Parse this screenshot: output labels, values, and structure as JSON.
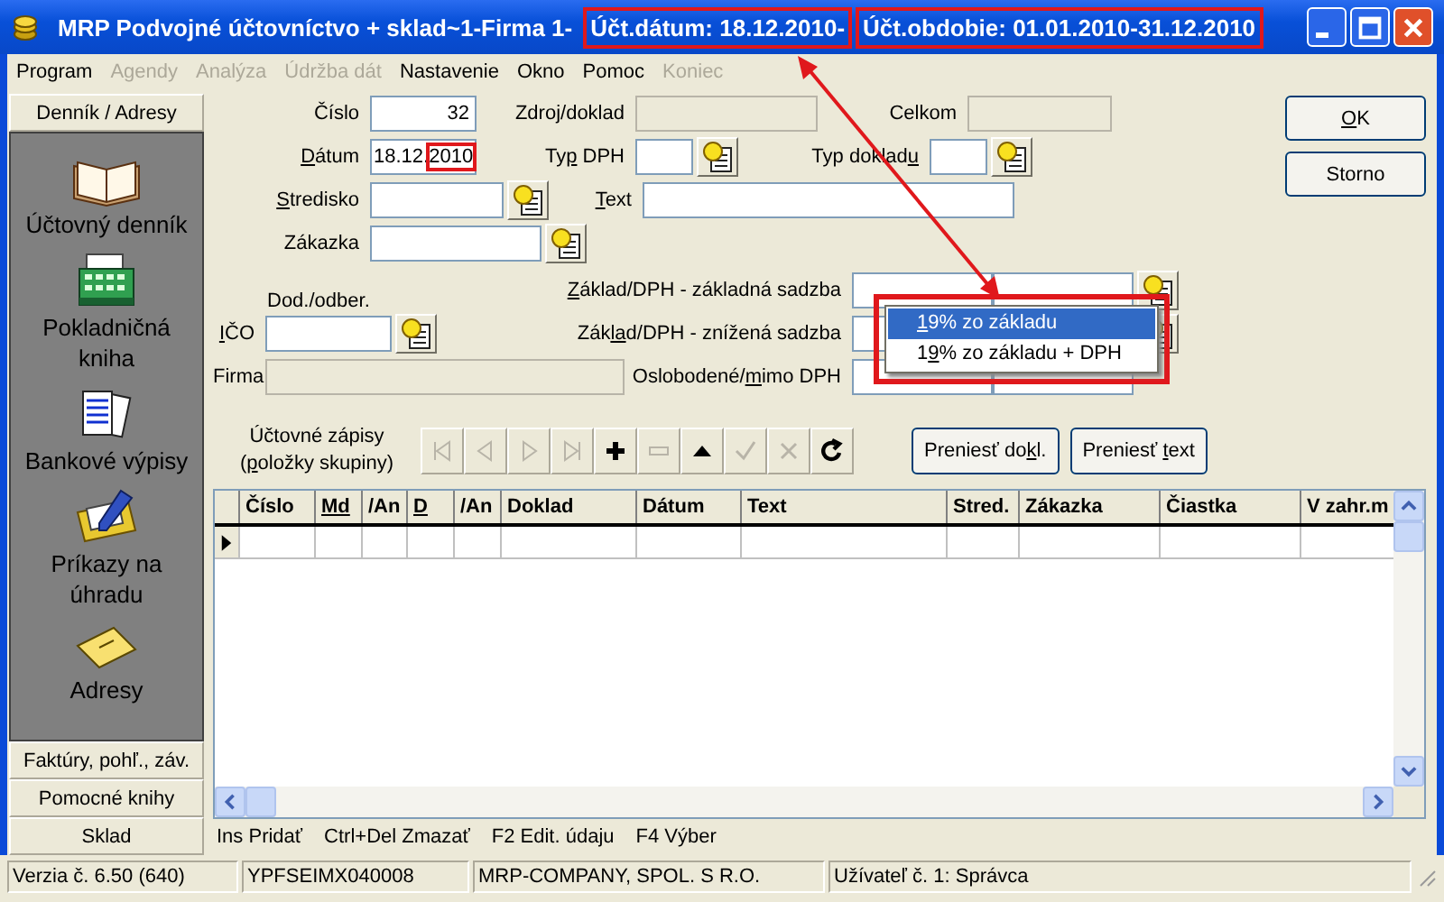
{
  "window": {
    "title_parts": [
      {
        "text": "MRP Podvojné účtovníctvo + sklad~1-Firma 1-",
        "highlighted": false
      },
      {
        "text": "Účt.dátum: 18.12.2010-",
        "highlighted": true
      },
      {
        "text": "Účt.obdobie: 01.01.2010-31.12.2010",
        "highlighted": true
      }
    ]
  },
  "menu": [
    {
      "label": "Program",
      "disabled": false
    },
    {
      "label": "Agendy",
      "disabled": true
    },
    {
      "label": "Analýza",
      "disabled": true
    },
    {
      "label": "Údržba dát",
      "disabled": true
    },
    {
      "label": "Nastavenie",
      "disabled": false
    },
    {
      "label": "Okno",
      "disabled": false
    },
    {
      "label": "Pomoc",
      "disabled": false
    },
    {
      "label": "Koniec",
      "disabled": true
    }
  ],
  "sidebar": {
    "header": "Denník / Adresy",
    "items": [
      {
        "kind": "book",
        "label": "Účtovný denník"
      },
      {
        "kind": "register",
        "label": "Pokladničná kniha"
      },
      {
        "kind": "documents",
        "label": "Bankové výpisy"
      },
      {
        "kind": "folder",
        "label": "Príkazy na úhradu"
      },
      {
        "kind": "envelope",
        "label": "Adresy"
      }
    ],
    "sections": [
      "Faktúry, pohľ., záv.",
      "Pomocné knihy",
      "Sklad"
    ]
  },
  "form": {
    "cislo": {
      "label": "Číslo",
      "value": "32"
    },
    "zdroj": {
      "label": "Zdroj/doklad"
    },
    "celkom": {
      "label": "Celkom"
    },
    "datum": {
      "label": {
        "key": "D",
        "post": "átum"
      },
      "value_parts": [
        {
          "text": "18.12.",
          "highlighted": false
        },
        {
          "text": "2010",
          "highlighted": true
        }
      ]
    },
    "typ_dph": {
      "label": {
        "pre": "Ty",
        "key": "p",
        "post": " DPH"
      }
    },
    "typ_dokladu": {
      "label": {
        "pre": "Typ doklad",
        "key": "u"
      }
    },
    "stredisko": {
      "label": {
        "key": "S",
        "post": "tredisko"
      }
    },
    "text": {
      "label": {
        "key": "T",
        "post": "ext"
      }
    },
    "zakazka": {
      "label": "Zákazka"
    },
    "dod_odber": "Dod./odber.",
    "ico": {
      "label": {
        "key": "I",
        "post": "ČO"
      }
    },
    "firma": {
      "label": "Firma"
    },
    "zakladna": {
      "label": {
        "key": "Z",
        "post": "áklad/DPH - základná sadzba"
      }
    },
    "znizena": {
      "label": {
        "pre": "Zák",
        "key": "la",
        "post": "d/DPH - znížená sadzba"
      }
    },
    "oslobodene": {
      "label": {
        "pre": "Oslobodené/",
        "key": "m",
        "post": "imo DPH"
      }
    }
  },
  "buttons": [
    {
      "label": {
        "key": "O",
        "post": "K"
      }
    },
    {
      "label": "Storno"
    }
  ],
  "dropdown": {
    "highlighted": true,
    "options": [
      {
        "label": {
          "key": "1",
          "post": "9% zo základu"
        },
        "selected": true
      },
      {
        "label": {
          "pre": "1",
          "key": "9",
          "post": "% zo základu + DPH"
        },
        "selected": false
      }
    ]
  },
  "entries": {
    "caption": [
      "Účtovné zápisy",
      {
        "pre": "(",
        "key": "p",
        "post": "oložky skupiny)"
      }
    ],
    "nav": [
      {
        "kind": "first",
        "disabled": true
      },
      {
        "kind": "prev",
        "disabled": true
      },
      {
        "kind": "next",
        "disabled": true
      },
      {
        "kind": "last",
        "disabled": true
      },
      {
        "kind": "add",
        "disabled": false
      },
      {
        "kind": "remove",
        "disabled": true
      },
      {
        "kind": "up",
        "disabled": false
      },
      {
        "kind": "confirm",
        "disabled": true
      },
      {
        "kind": "cancel",
        "disabled": true
      },
      {
        "kind": "refresh",
        "disabled": false
      }
    ],
    "buttons": [
      {
        "pre": "Preniesť do",
        "key": "k",
        "post": "l."
      },
      {
        "pre": "Preniesť ",
        "key": "t",
        "post": "ext"
      }
    ]
  },
  "table": {
    "columns": [
      {
        "label": "Číslo",
        "underlined": false
      },
      {
        "label": "Md",
        "underlined": true
      },
      {
        "label": "/An",
        "underlined": false
      },
      {
        "label": "D",
        "underlined": true
      },
      {
        "label": "/An",
        "underlined": false
      },
      {
        "label": "Doklad",
        "underlined": false
      },
      {
        "label": "Dátum",
        "underlined": false
      },
      {
        "label": "Text",
        "underlined": false
      },
      {
        "label": "Stred.",
        "underlined": false
      },
      {
        "label": "Zákazka",
        "underlined": false
      },
      {
        "label": "Čiastka",
        "underlined": false
      },
      {
        "label": "V zahr.m",
        "underlined": false
      }
    ]
  },
  "hints": [
    "Ins Pridať",
    "Ctrl+Del Zmazať",
    "F2 Edit. údaju",
    "F4 Výber"
  ],
  "status_bar": [
    "Verzia č. 6.50 (640)",
    "YPFSEIMX040008",
    "MRP-COMPANY, SPOL. S R.O.",
    "Užívateľ č. 1: Správca"
  ]
}
